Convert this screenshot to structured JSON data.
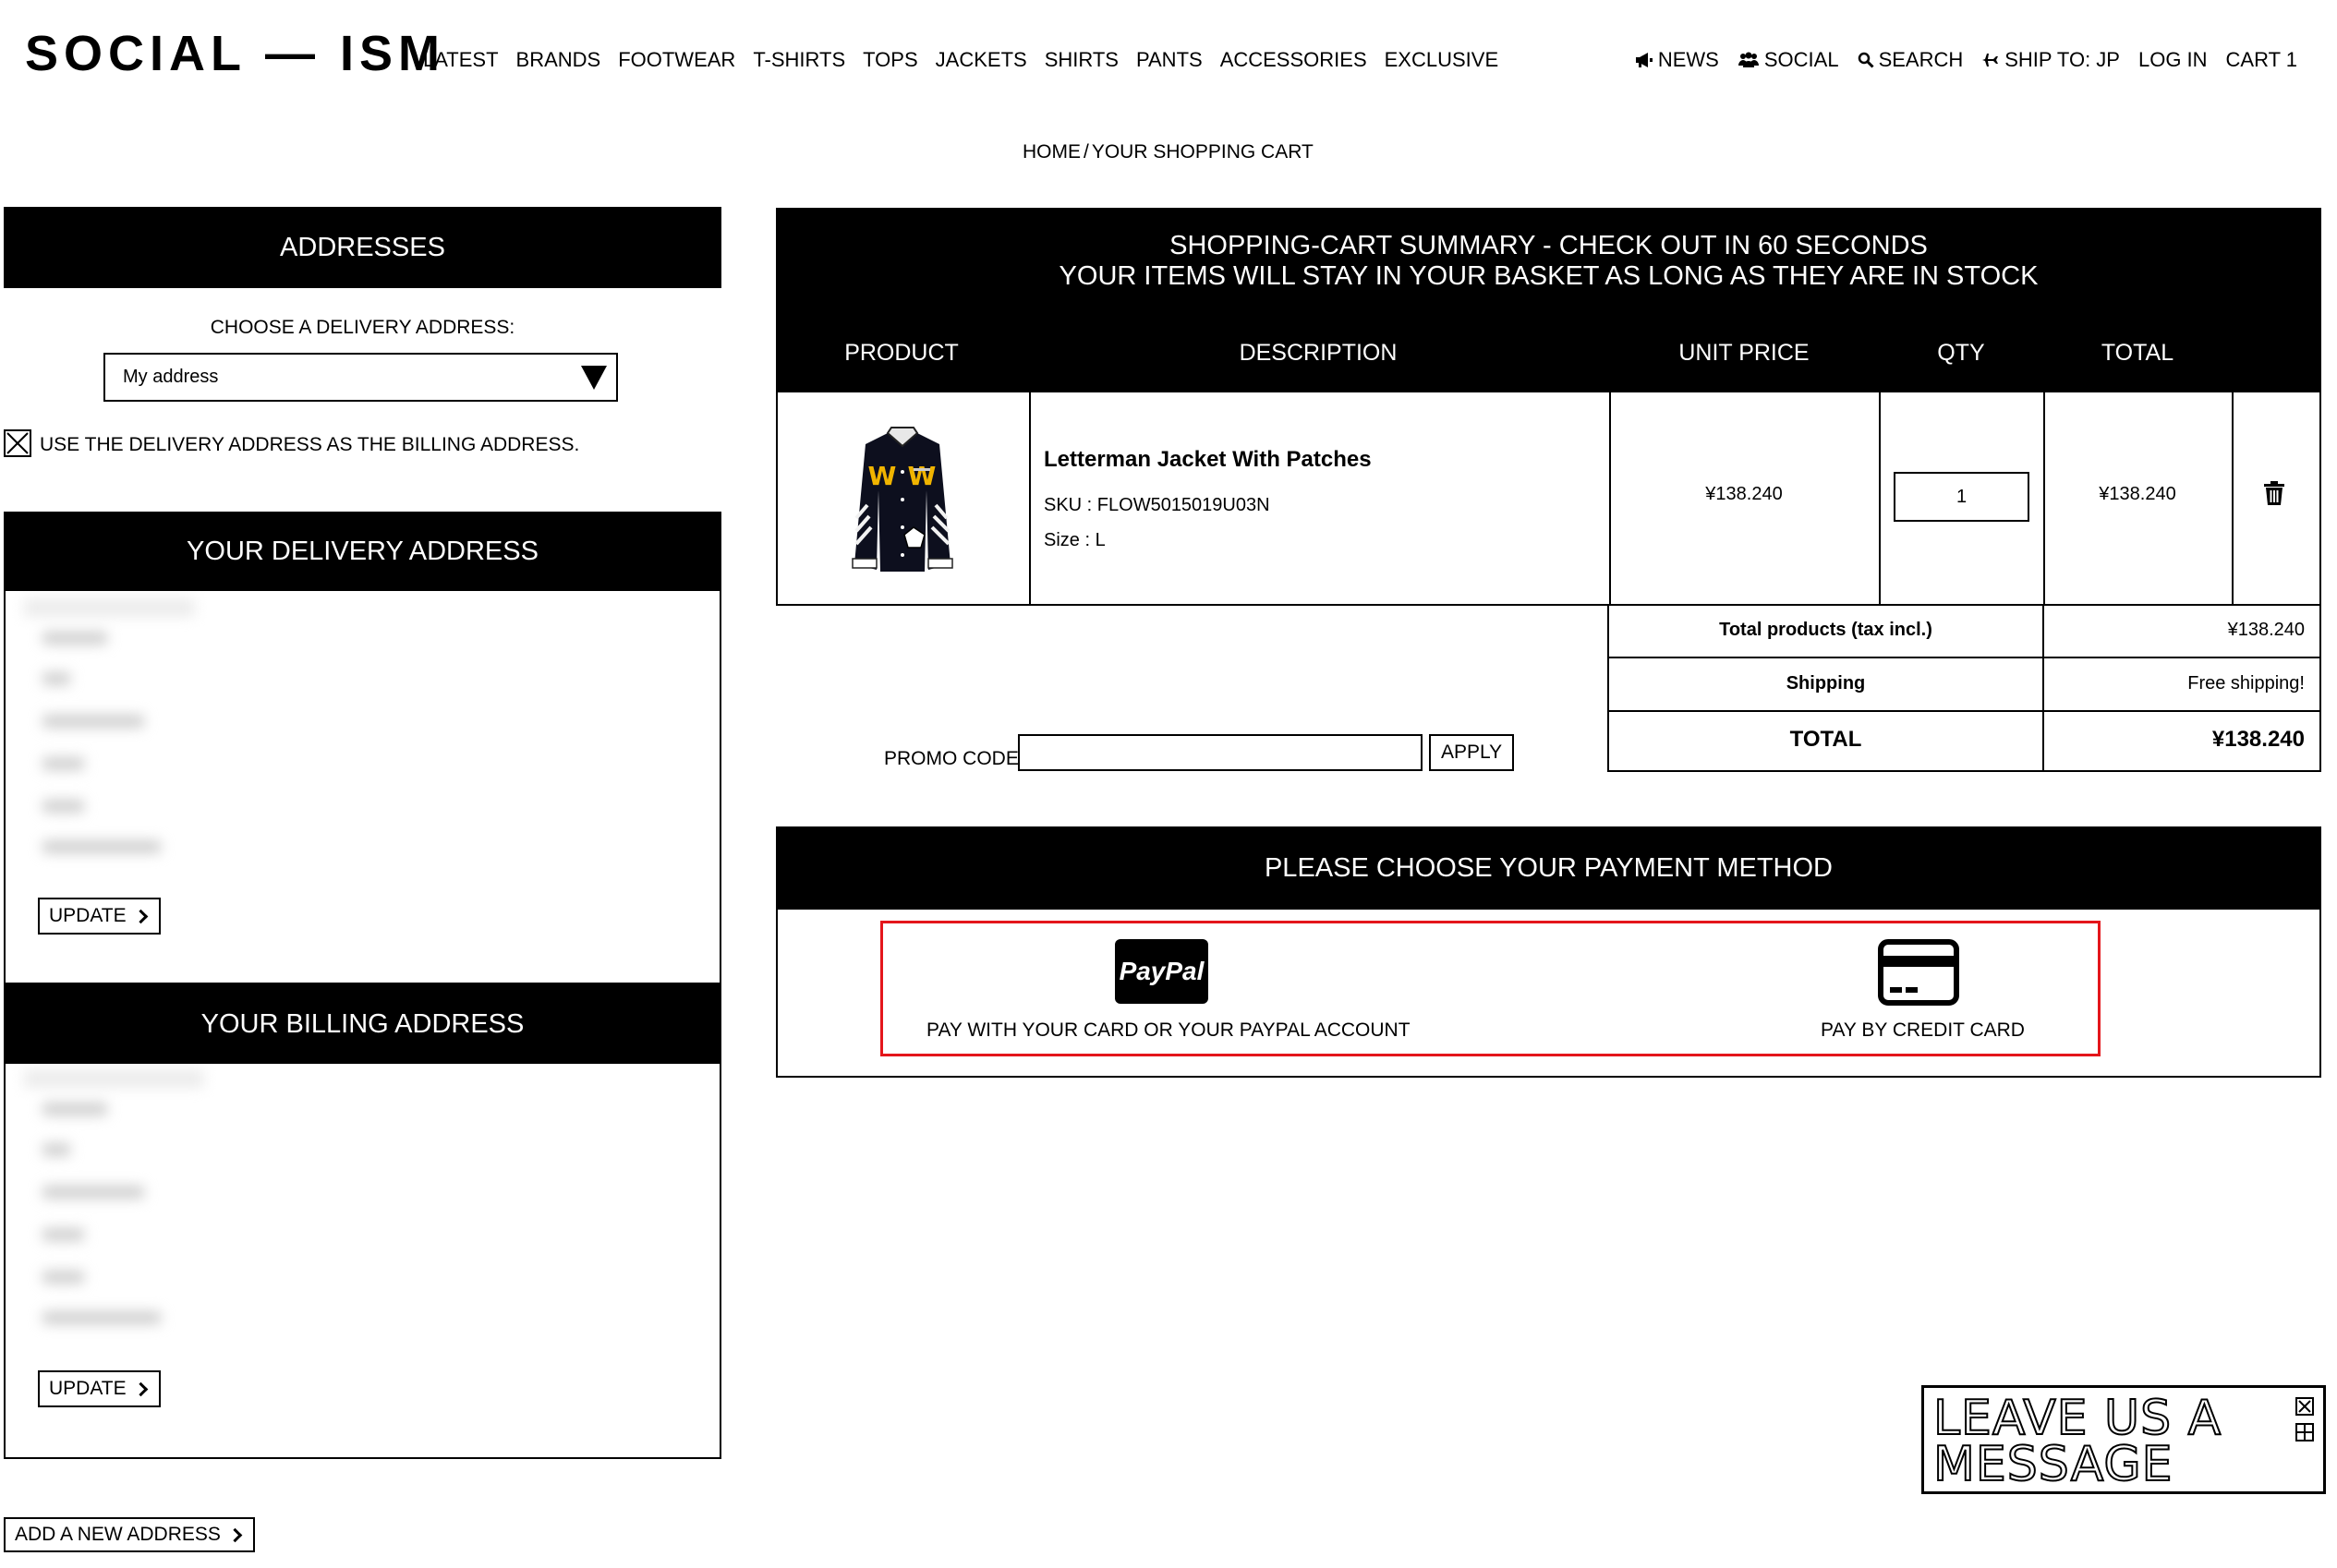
{
  "header": {
    "logo": "SOCIAL — ISM",
    "nav": [
      "LATEST",
      "BRANDS",
      "FOOTWEAR",
      "T-SHIRTS",
      "TOPS",
      "JACKETS",
      "SHIRTS",
      "PANTS",
      "ACCESSORIES",
      "EXCLUSIVE"
    ],
    "util": {
      "news": "NEWS",
      "social": "SOCIAL",
      "search": "SEARCH",
      "ship": "SHIP TO: JP",
      "login": "LOG IN",
      "cart": "CART 1"
    }
  },
  "breadcrumb": {
    "home": "HOME",
    "separator": "/",
    "current": "YOUR SHOPPING CART"
  },
  "addresses": {
    "title": "ADDRESSES",
    "choose_label": "CHOOSE A DELIVERY ADDRESS:",
    "selected": "My address",
    "same_billing_label": "USE THE DELIVERY ADDRESS AS THE BILLING ADDRESS.",
    "same_billing_checked": true,
    "delivery_title": "YOUR DELIVERY ADDRESS",
    "billing_title": "YOUR BILLING ADDRESS",
    "update_label": "UPDATE",
    "add_label": "ADD A NEW ADDRESS"
  },
  "cart": {
    "title_line1": "SHOPPING-CART SUMMARY - CHECK OUT IN 60 SECONDS",
    "title_line2": "YOUR ITEMS WILL STAY IN YOUR BASKET AS LONG AS THEY ARE IN STOCK",
    "columns": {
      "product": "PRODUCT",
      "description": "DESCRIPTION",
      "unit_price": "UNIT PRICE",
      "qty": "QTY",
      "total": "TOTAL"
    },
    "item": {
      "name": "Letterman Jacket With Patches",
      "sku": "SKU : FLOW5015019U03N",
      "size": "Size : L",
      "unit_price": "¥138.240",
      "qty": "1",
      "total": "¥138.240"
    },
    "totals": {
      "products_label": "Total products (tax incl.)",
      "products_value": "¥138.240",
      "shipping_label": "Shipping",
      "shipping_value": "Free shipping!",
      "total_label": "TOTAL",
      "total_value": "¥138.240"
    },
    "promo": {
      "label": "PROMO CODE",
      "value": "",
      "apply": "APPLY"
    }
  },
  "payment": {
    "title": "PLEASE CHOOSE YOUR PAYMENT METHOD",
    "paypal_logo": "PayPal",
    "paypal_label": "PAY WITH YOUR CARD OR YOUR PAYPAL ACCOUNT",
    "card_label": "PAY BY CREDIT CARD",
    "highlight_color": "#e4161b"
  },
  "chat": {
    "line1": "LEAVE US A",
    "line2": "MESSAGE"
  }
}
